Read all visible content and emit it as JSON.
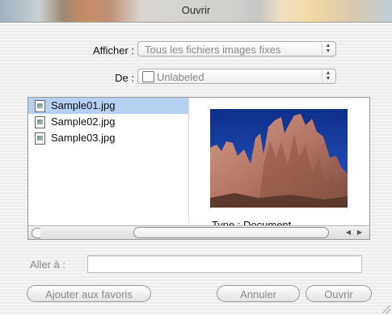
{
  "window": {
    "title": "Ouvrir"
  },
  "filters": {
    "show_label": "Afficher :",
    "show_value": "Tous les fichiers images fixes",
    "from_label": "De :",
    "from_value": "Unlabeled"
  },
  "file_list": {
    "items": [
      {
        "name": "Sample01.jpg",
        "selected": true
      },
      {
        "name": "Sample02.jpg",
        "selected": false
      },
      {
        "name": "Sample03.jpg",
        "selected": false
      }
    ]
  },
  "preview": {
    "type_text": "Type : Document"
  },
  "goto": {
    "label": "Aller à :",
    "value": ""
  },
  "buttons": {
    "add_favorites": "Ajouter aux favoris",
    "cancel": "Annuler",
    "open": "Ouvrir"
  }
}
